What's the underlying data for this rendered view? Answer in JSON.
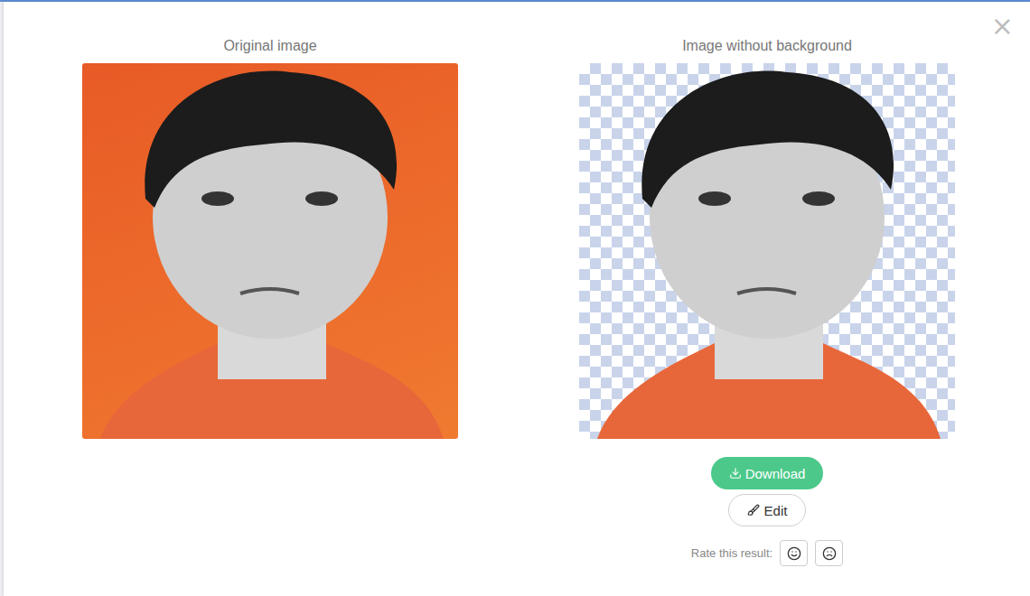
{
  "modal": {
    "close": "×"
  },
  "panels": [
    {
      "title": "Original image",
      "kind": "original"
    },
    {
      "title": "Image without background",
      "kind": "transparent"
    }
  ],
  "actions": {
    "download": "Download",
    "edit": "Edit"
  },
  "rating": {
    "label": "Rate this result:",
    "options": [
      {
        "name": "happy",
        "selected": false
      },
      {
        "name": "sad",
        "selected": false
      }
    ]
  }
}
